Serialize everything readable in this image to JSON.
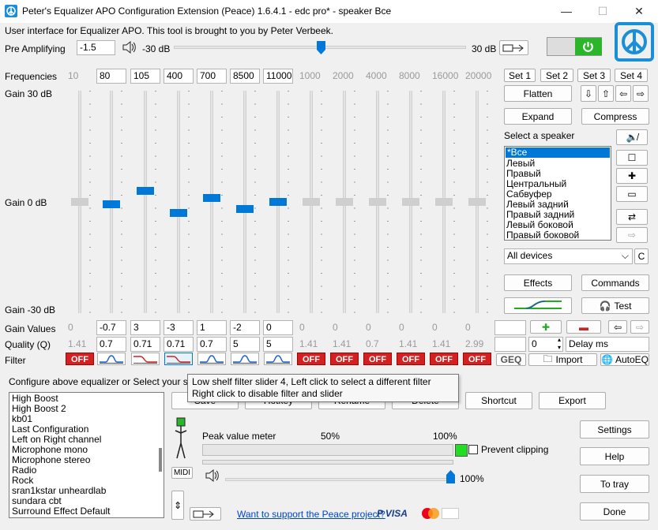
{
  "window": {
    "title": "Peter's Equalizer APO Configuration Extension (Peace) 1.6.4.1 - edc pro* - speaker Все",
    "minimize": "—",
    "maximize": "☐",
    "close": "✕"
  },
  "header": {
    "info": "User interface for Equalizer APO. This tool is brought to you by Peter Verbeek.",
    "pre_amp_label": "Pre Amplifying",
    "pre_amp_value": "-1.5",
    "min_db": "-30 dB",
    "max_db": "30 dB",
    "pre_amp_fraction": 0.5
  },
  "labels": {
    "frequencies": "Frequencies",
    "gain_top": "Gain 30 dB",
    "gain_mid": "Gain 0 dB",
    "gain_bottom": "Gain -30 dB",
    "gain_values": "Gain Values",
    "quality": "Quality (Q)",
    "filter": "Filter"
  },
  "frequencies": [
    "10",
    "80",
    "105",
    "400",
    "700",
    "8500",
    "11000",
    "1000",
    "2000",
    "4000",
    "8000",
    "16000",
    "20000"
  ],
  "gains": [
    "0",
    "-0.7",
    "3",
    "-3",
    "1",
    "-2",
    "0",
    "0",
    "0",
    "0",
    "0",
    "0",
    "0"
  ],
  "qualities": [
    "1.41",
    "0.7",
    "0.71",
    "0.71",
    "0.7",
    "5",
    "5",
    "1.41",
    "1.41",
    "0.7",
    "1.41",
    "1.41",
    "2.99"
  ],
  "active": [
    false,
    true,
    true,
    true,
    true,
    true,
    true,
    false,
    false,
    false,
    false,
    false,
    false
  ],
  "filters": [
    "OFF",
    "peak",
    "lowshelf",
    "lowshelf",
    "peak",
    "peak",
    "peak",
    "OFF",
    "OFF",
    "OFF",
    "OFF",
    "OFF",
    "OFF"
  ],
  "slider_gain_values": [
    0,
    -0.7,
    3,
    -3,
    1,
    -2,
    0,
    0,
    0,
    0,
    0,
    0,
    0
  ],
  "gain_range": [
    -30,
    30
  ],
  "right_panel": {
    "set1": "Set 1",
    "set2": "Set 2",
    "set3": "Set 3",
    "set4": "Set 4",
    "flatten": "Flatten",
    "expand": "Expand",
    "compress": "Compress",
    "select_speaker": "Select a speaker",
    "devices": "All devices",
    "device_c": "C",
    "effects": "Effects",
    "commands": "Commands",
    "test": "Test",
    "import": "Import",
    "autoeq": "AutoEQ",
    "geq": "GEQ",
    "extra_value": "0",
    "delay": "Delay ms"
  },
  "speakers": [
    "*Все",
    "Левый",
    "Правый",
    "Центральный",
    "Сабвуфер",
    "Левый задний",
    "Правый задний",
    "Левый боковой",
    "Правый боковой"
  ],
  "bottom": {
    "configure_text": "Configure above equalizer or Select your saved",
    "tooltip_line1": "Low shelf filter slider 4, Left click to select a different filter",
    "tooltip_line2": "Right click to disable filter and slider",
    "save": "Save",
    "hotkey": "Hotkey",
    "rename": "Rename",
    "delete": "Delete",
    "shortcut": "Shortcut",
    "export": "Export",
    "settings": "Settings",
    "help": "Help",
    "to_tray": "To tray",
    "done": "Done",
    "peak_meter": "Peak value meter",
    "p50": "50%",
    "p100": "100%",
    "prevent_clipping": "Prevent clipping",
    "volume": "100%",
    "midi": "MIDI",
    "support_link": "Want to support the Peace project?",
    "volume_fraction": 1.0
  },
  "configs": [
    "High Boost",
    "High Boost 2",
    "kb01",
    "Last Configuration",
    "Left on Right channel",
    "Microphone mono",
    "Microphone stereo",
    "Radio",
    "Rock",
    "sran1kstar unheardlab",
    "sundara cbt",
    "Surround Effect Default"
  ],
  "colors": {
    "accent": "#0078d7",
    "off_red": "#d32020",
    "logo_blue": "#1a8fd8",
    "power_green": "#2bb52b",
    "peak_green": "#22dd22"
  }
}
